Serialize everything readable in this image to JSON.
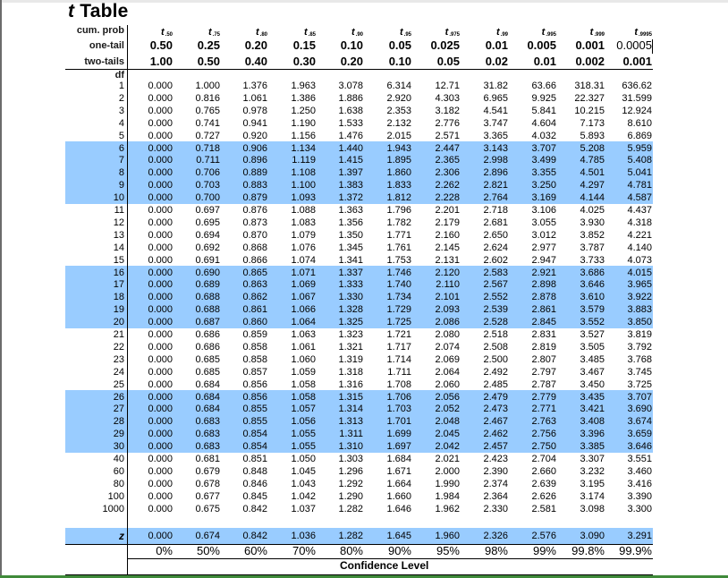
{
  "title": {
    "italic": "t",
    "text": "Table"
  },
  "header": {
    "cum_prob_label": "cum. prob",
    "one_tail_label": "one-tail",
    "two_tails_label": "two-tails",
    "df_label": "df",
    "columns": [
      {
        "cum_prob": ".50",
        "one_tail": "0.50",
        "two_tails": "1.00"
      },
      {
        "cum_prob": ".75",
        "one_tail": "0.25",
        "two_tails": "0.50"
      },
      {
        "cum_prob": ".80",
        "one_tail": "0.20",
        "two_tails": "0.40"
      },
      {
        "cum_prob": ".85",
        "one_tail": "0.15",
        "two_tails": "0.30"
      },
      {
        "cum_prob": ".90",
        "one_tail": "0.10",
        "two_tails": "0.20"
      },
      {
        "cum_prob": ".95",
        "one_tail": "0.05",
        "two_tails": "0.10"
      },
      {
        "cum_prob": ".975",
        "one_tail": "0.025",
        "two_tails": "0.05"
      },
      {
        "cum_prob": ".99",
        "one_tail": "0.01",
        "two_tails": "0.02"
      },
      {
        "cum_prob": ".995",
        "one_tail": "0.005",
        "two_tails": "0.01"
      },
      {
        "cum_prob": ".999",
        "one_tail": "0.001",
        "two_tails": "0.002"
      },
      {
        "cum_prob": ".9995",
        "one_tail": "0.0005",
        "two_tails": "0.001"
      }
    ]
  },
  "rows": [
    {
      "df": "1",
      "values": [
        "0.000",
        "1.000",
        "1.376",
        "1.963",
        "3.078",
        "6.314",
        "12.71",
        "31.82",
        "63.66",
        "318.31",
        "636.62"
      ]
    },
    {
      "df": "2",
      "values": [
        "0.000",
        "0.816",
        "1.061",
        "1.386",
        "1.886",
        "2.920",
        "4.303",
        "6.965",
        "9.925",
        "22.327",
        "31.599"
      ]
    },
    {
      "df": "3",
      "values": [
        "0.000",
        "0.765",
        "0.978",
        "1.250",
        "1.638",
        "2.353",
        "3.182",
        "4.541",
        "5.841",
        "10.215",
        "12.924"
      ]
    },
    {
      "df": "4",
      "values": [
        "0.000",
        "0.741",
        "0.941",
        "1.190",
        "1.533",
        "2.132",
        "2.776",
        "3.747",
        "4.604",
        "7.173",
        "8.610"
      ]
    },
    {
      "df": "5",
      "values": [
        "0.000",
        "0.727",
        "0.920",
        "1.156",
        "1.476",
        "2.015",
        "2.571",
        "3.365",
        "4.032",
        "5.893",
        "6.869"
      ]
    },
    {
      "df": "6",
      "values": [
        "0.000",
        "0.718",
        "0.906",
        "1.134",
        "1.440",
        "1.943",
        "2.447",
        "3.143",
        "3.707",
        "5.208",
        "5.959"
      ]
    },
    {
      "df": "7",
      "values": [
        "0.000",
        "0.711",
        "0.896",
        "1.119",
        "1.415",
        "1.895",
        "2.365",
        "2.998",
        "3.499",
        "4.785",
        "5.408"
      ]
    },
    {
      "df": "8",
      "values": [
        "0.000",
        "0.706",
        "0.889",
        "1.108",
        "1.397",
        "1.860",
        "2.306",
        "2.896",
        "3.355",
        "4.501",
        "5.041"
      ]
    },
    {
      "df": "9",
      "values": [
        "0.000",
        "0.703",
        "0.883",
        "1.100",
        "1.383",
        "1.833",
        "2.262",
        "2.821",
        "3.250",
        "4.297",
        "4.781"
      ]
    },
    {
      "df": "10",
      "values": [
        "0.000",
        "0.700",
        "0.879",
        "1.093",
        "1.372",
        "1.812",
        "2.228",
        "2.764",
        "3.169",
        "4.144",
        "4.587"
      ]
    },
    {
      "df": "11",
      "values": [
        "0.000",
        "0.697",
        "0.876",
        "1.088",
        "1.363",
        "1.796",
        "2.201",
        "2.718",
        "3.106",
        "4.025",
        "4.437"
      ]
    },
    {
      "df": "12",
      "values": [
        "0.000",
        "0.695",
        "0.873",
        "1.083",
        "1.356",
        "1.782",
        "2.179",
        "2.681",
        "3.055",
        "3.930",
        "4.318"
      ]
    },
    {
      "df": "13",
      "values": [
        "0.000",
        "0.694",
        "0.870",
        "1.079",
        "1.350",
        "1.771",
        "2.160",
        "2.650",
        "3.012",
        "3.852",
        "4.221"
      ]
    },
    {
      "df": "14",
      "values": [
        "0.000",
        "0.692",
        "0.868",
        "1.076",
        "1.345",
        "1.761",
        "2.145",
        "2.624",
        "2.977",
        "3.787",
        "4.140"
      ]
    },
    {
      "df": "15",
      "values": [
        "0.000",
        "0.691",
        "0.866",
        "1.074",
        "1.341",
        "1.753",
        "2.131",
        "2.602",
        "2.947",
        "3.733",
        "4.073"
      ]
    },
    {
      "df": "16",
      "values": [
        "0.000",
        "0.690",
        "0.865",
        "1.071",
        "1.337",
        "1.746",
        "2.120",
        "2.583",
        "2.921",
        "3.686",
        "4.015"
      ]
    },
    {
      "df": "17",
      "values": [
        "0.000",
        "0.689",
        "0.863",
        "1.069",
        "1.333",
        "1.740",
        "2.110",
        "2.567",
        "2.898",
        "3.646",
        "3.965"
      ]
    },
    {
      "df": "18",
      "values": [
        "0.000",
        "0.688",
        "0.862",
        "1.067",
        "1.330",
        "1.734",
        "2.101",
        "2.552",
        "2.878",
        "3.610",
        "3.922"
      ]
    },
    {
      "df": "19",
      "values": [
        "0.000",
        "0.688",
        "0.861",
        "1.066",
        "1.328",
        "1.729",
        "2.093",
        "2.539",
        "2.861",
        "3.579",
        "3.883"
      ]
    },
    {
      "df": "20",
      "values": [
        "0.000",
        "0.687",
        "0.860",
        "1.064",
        "1.325",
        "1.725",
        "2.086",
        "2.528",
        "2.845",
        "3.552",
        "3.850"
      ]
    },
    {
      "df": "21",
      "values": [
        "0.000",
        "0.686",
        "0.859",
        "1.063",
        "1.323",
        "1.721",
        "2.080",
        "2.518",
        "2.831",
        "3.527",
        "3.819"
      ]
    },
    {
      "df": "22",
      "values": [
        "0.000",
        "0.686",
        "0.858",
        "1.061",
        "1.321",
        "1.717",
        "2.074",
        "2.508",
        "2.819",
        "3.505",
        "3.792"
      ]
    },
    {
      "df": "23",
      "values": [
        "0.000",
        "0.685",
        "0.858",
        "1.060",
        "1.319",
        "1.714",
        "2.069",
        "2.500",
        "2.807",
        "3.485",
        "3.768"
      ]
    },
    {
      "df": "24",
      "values": [
        "0.000",
        "0.685",
        "0.857",
        "1.059",
        "1.318",
        "1.711",
        "2.064",
        "2.492",
        "2.797",
        "3.467",
        "3.745"
      ]
    },
    {
      "df": "25",
      "values": [
        "0.000",
        "0.684",
        "0.856",
        "1.058",
        "1.316",
        "1.708",
        "2.060",
        "2.485",
        "2.787",
        "3.450",
        "3.725"
      ]
    },
    {
      "df": "26",
      "values": [
        "0.000",
        "0.684",
        "0.856",
        "1.058",
        "1.315",
        "1.706",
        "2.056",
        "2.479",
        "2.779",
        "3.435",
        "3.707"
      ]
    },
    {
      "df": "27",
      "values": [
        "0.000",
        "0.684",
        "0.855",
        "1.057",
        "1.314",
        "1.703",
        "2.052",
        "2.473",
        "2.771",
        "3.421",
        "3.690"
      ]
    },
    {
      "df": "28",
      "values": [
        "0.000",
        "0.683",
        "0.855",
        "1.056",
        "1.313",
        "1.701",
        "2.048",
        "2.467",
        "2.763",
        "3.408",
        "3.674"
      ]
    },
    {
      "df": "29",
      "values": [
        "0.000",
        "0.683",
        "0.854",
        "1.055",
        "1.311",
        "1.699",
        "2.045",
        "2.462",
        "2.756",
        "3.396",
        "3.659"
      ]
    },
    {
      "df": "30",
      "values": [
        "0.000",
        "0.683",
        "0.854",
        "1.055",
        "1.310",
        "1.697",
        "2.042",
        "2.457",
        "2.750",
        "3.385",
        "3.646"
      ]
    },
    {
      "df": "40",
      "values": [
        "0.000",
        "0.681",
        "0.851",
        "1.050",
        "1.303",
        "1.684",
        "2.021",
        "2.423",
        "2.704",
        "3.307",
        "3.551"
      ]
    },
    {
      "df": "60",
      "values": [
        "0.000",
        "0.679",
        "0.848",
        "1.045",
        "1.296",
        "1.671",
        "2.000",
        "2.390",
        "2.660",
        "3.232",
        "3.460"
      ]
    },
    {
      "df": "80",
      "values": [
        "0.000",
        "0.678",
        "0.846",
        "1.043",
        "1.292",
        "1.664",
        "1.990",
        "2.374",
        "2.639",
        "3.195",
        "3.416"
      ]
    },
    {
      "df": "100",
      "values": [
        "0.000",
        "0.677",
        "0.845",
        "1.042",
        "1.290",
        "1.660",
        "1.984",
        "2.364",
        "2.626",
        "3.174",
        "3.390"
      ]
    },
    {
      "df": "1000",
      "values": [
        "0.000",
        "0.675",
        "0.842",
        "1.037",
        "1.282",
        "1.646",
        "1.962",
        "2.330",
        "2.581",
        "3.098",
        "3.300"
      ]
    }
  ],
  "z_row": {
    "label": "z",
    "values": [
      "0.000",
      "0.674",
      "0.842",
      "1.036",
      "1.282",
      "1.645",
      "1.960",
      "2.326",
      "2.576",
      "3.090",
      "3.291"
    ]
  },
  "confidence": {
    "levels": [
      "0%",
      "50%",
      "60%",
      "70%",
      "80%",
      "90%",
      "95%",
      "98%",
      "99%",
      "99.8%",
      "99.9%"
    ],
    "label": "Confidence Level"
  },
  "highlight_color": "#99ccff",
  "highlighted_df_groups": [
    [
      "6",
      "10"
    ],
    [
      "16",
      "20"
    ],
    [
      "26",
      "30"
    ]
  ]
}
